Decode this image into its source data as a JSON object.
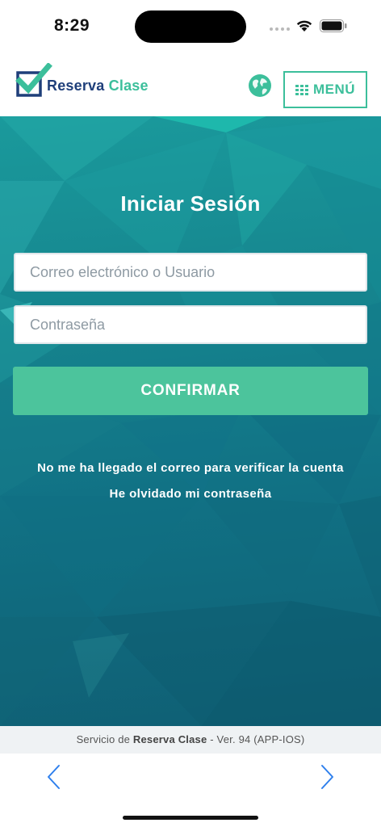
{
  "status_bar": {
    "time": "8:29"
  },
  "header": {
    "logo_word1": "Reserva",
    "logo_word2": "Clase",
    "menu_label": "MENÚ",
    "icons": [
      "globe-icon",
      "grid-icon"
    ]
  },
  "login": {
    "title": "Iniciar Sesión",
    "email_placeholder": "Correo electrónico o Usuario",
    "password_placeholder": "Contraseña",
    "confirm_label": "CONFIRMAR",
    "link_verify": "No me ha llegado el correo para verificar la cuenta",
    "link_forgot": "He olvidado mi contraseña"
  },
  "footer": {
    "prefix": "Servicio de",
    "brand": "Reserva Clase",
    "suffix": "- Ver. 94 (APP-IOS)"
  },
  "nav": {
    "icons": [
      "chevron-left-icon",
      "chevron-right-icon"
    ]
  },
  "colors": {
    "accent": "#3cbf9b",
    "brand_dark": "#1f3f7a",
    "confirm": "#4cc49c",
    "hero_top": "#1a9a9c",
    "hero_bottom": "#0f5f74"
  }
}
